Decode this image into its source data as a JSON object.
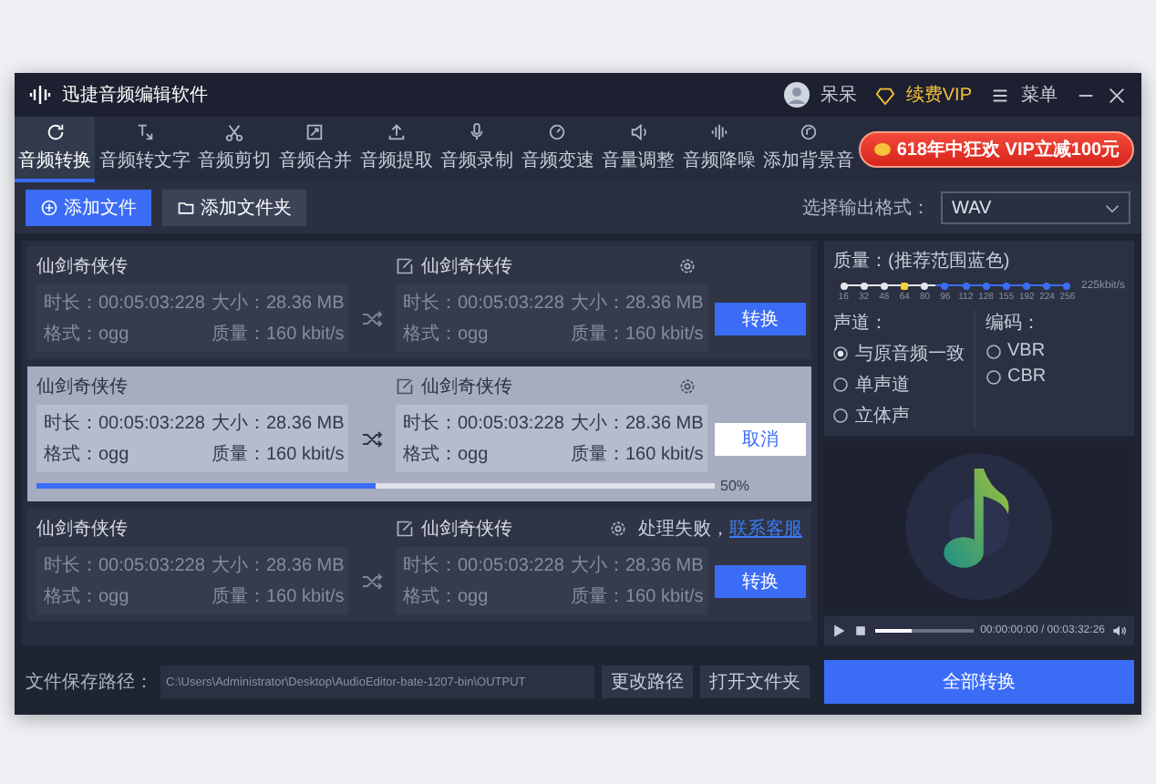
{
  "window": {
    "title": "迅捷音频编辑软件",
    "user": "呆呆",
    "vip": "续费VIP",
    "menu": "菜单"
  },
  "tabs": [
    {
      "label": "音频转换",
      "selected": true
    },
    {
      "label": "音频转文字",
      "selected": false
    },
    {
      "label": "音频剪切",
      "selected": false
    },
    {
      "label": "音频合并",
      "selected": false
    },
    {
      "label": "音频提取",
      "selected": false
    },
    {
      "label": "音频录制",
      "selected": false
    },
    {
      "label": "音频变速",
      "selected": false
    },
    {
      "label": "音量调整",
      "selected": false
    },
    {
      "label": "音频降噪",
      "selected": false
    },
    {
      "label": "添加背景音",
      "selected": false
    }
  ],
  "promo": "618年中狂欢 VIP立减100元",
  "actions": {
    "add_file": "添加文件",
    "add_folder": "添加文件夹",
    "format_label": "选择输出格式：",
    "format_value": "WAV"
  },
  "tasks": [
    {
      "name": "仙剑奇侠传",
      "output_name": "仙剑奇侠传",
      "selected": false,
      "source": [
        "时长：00:05:03:228",
        "大小：28.36 MB",
        "格式：ogg",
        "质量：160 kbit/s"
      ],
      "output": [
        "时长：00:05:03:228",
        "大小：28.36 MB",
        "格式：ogg",
        "质量：160 kbit/s"
      ],
      "button": "转换"
    },
    {
      "name": "仙剑奇侠传",
      "output_name": "仙剑奇侠传",
      "selected": true,
      "source": [
        "时长：00:05:03:228",
        "大小：28.36 MB",
        "格式：ogg",
        "质量：160 kbit/s"
      ],
      "output": [
        "时长：00:05:03:228",
        "大小：28.36 MB",
        "格式：ogg",
        "质量：160 kbit/s"
      ],
      "button": "取消",
      "progress": {
        "level": 0.5,
        "reading": "50%"
      }
    },
    {
      "name": "仙剑奇侠传",
      "output_name": "仙剑奇侠传",
      "selected": false,
      "failure": "处理失败，",
      "support_link": "联系客服",
      "source": [
        "时长：00:05:03:228",
        "大小：28.36 MB",
        "格式：ogg",
        "质量：160 kbit/s"
      ],
      "output": [
        "时长：00:05:03:228",
        "大小：28.36 MB",
        "格式：ogg",
        "质量：160 kbit/s"
      ],
      "button": "转换"
    }
  ],
  "quality": {
    "label": "质量：(推荐范围蓝色)",
    "reading": "225kbit/s",
    "ticks": [
      {
        "label": "16",
        "recommended": false,
        "selected": false
      },
      {
        "label": "32",
        "recommended": false,
        "selected": false
      },
      {
        "label": "48",
        "recommended": false,
        "selected": false
      },
      {
        "label": "64",
        "recommended": false,
        "selected": true
      },
      {
        "label": "80",
        "recommended": false,
        "selected": false
      },
      {
        "label": "96",
        "recommended": true,
        "selected": false
      },
      {
        "label": "112",
        "recommended": true,
        "selected": false
      },
      {
        "label": "128",
        "recommended": true,
        "selected": false
      },
      {
        "label": "155",
        "recommended": true,
        "selected": false
      },
      {
        "label": "192",
        "recommended": true,
        "selected": false
      },
      {
        "label": "224",
        "recommended": true,
        "selected": false
      },
      {
        "label": "256",
        "recommended": true,
        "selected": false
      }
    ]
  },
  "channel": {
    "label": "声道：",
    "options": [
      {
        "label": "与原音频一致",
        "selected": true
      },
      {
        "label": "单声道",
        "selected": false
      },
      {
        "label": "立体声",
        "selected": false
      }
    ]
  },
  "encoding": {
    "label": "编码：",
    "options": [
      {
        "label": "VBR",
        "selected": false
      },
      {
        "label": "CBR",
        "selected": false
      }
    ]
  },
  "player": {
    "level": 0.37,
    "time": "00:00:00:00 / 00:03:32:26"
  },
  "footer": {
    "path_label": "文件保存路径：",
    "path": "C:\\Users\\Administrator\\Desktop\\AudioEditor-bate-1207-bin\\OUTPUT",
    "change_path": "更改路径",
    "open_folder": "打开文件夹",
    "convert_all": "全部转换"
  }
}
